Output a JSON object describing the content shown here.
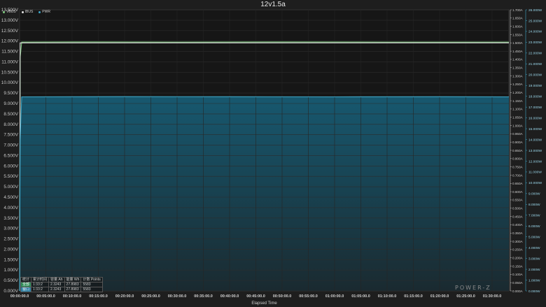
{
  "window": {
    "title": "12v1.5a"
  },
  "brand": "POWER-Z",
  "legend": [
    {
      "label": "VBUS",
      "color": "#7fc97f"
    },
    {
      "label": "IBUS",
      "color": "#e0e0e0"
    },
    {
      "label": "PWR",
      "color": "#3fa7c8"
    }
  ],
  "stats": {
    "header": [
      "统计",
      "累计时间",
      "容量 Ah",
      "能量 Wh",
      "计数 Points"
    ],
    "rows": [
      {
        "label": "全部",
        "time": "1:33:2",
        "ah": "2.3243",
        "wh": "27.8983",
        "points": "5583",
        "color": "#2e8b57"
      },
      {
        "label": "窗口",
        "time": "1:33:2",
        "ah": "2.3243",
        "wh": "27.8983",
        "points": "5583",
        "color": "#2d7fa3"
      }
    ]
  },
  "chart_data": {
    "type": "line",
    "title": "12v1.5a",
    "xlabel": "Elapsed Time",
    "x_ticks": [
      "00:00:00.0",
      "00:05:00.0",
      "00:10:00.0",
      "00:15:00.0",
      "00:20:00.0",
      "00:25:00.0",
      "00:30:00.0",
      "00:35:00.0",
      "00:40:00.0",
      "00:45:00.0",
      "00:50:00.0",
      "00:55:00.0",
      "01:00:00.0",
      "01:05:00.0",
      "01:10:00.0",
      "01:15:00.0",
      "01:20:00.0",
      "01:25:00.0",
      "01:30:00.0"
    ],
    "x_range_min": [
      0,
      93.2
    ],
    "y_left": {
      "unit": "V",
      "range": [
        0,
        13.5
      ],
      "ticks": [
        "0.000V",
        "0.500V",
        "1.000V",
        "1.500V",
        "2.000V",
        "2.500V",
        "3.000V",
        "3.500V",
        "4.000V",
        "4.500V",
        "5.000V",
        "5.500V",
        "6.000V",
        "6.500V",
        "7.000V",
        "7.500V",
        "8.000V",
        "8.500V",
        "9.000V",
        "9.500V",
        "10.000V",
        "10.500V",
        "11.000V",
        "11.500V",
        "12.000V",
        "12.500V",
        "13.000V",
        "13.500V"
      ]
    },
    "y_right_current": {
      "unit": "A",
      "range": [
        0,
        1.7
      ],
      "ticks": [
        "0.000A",
        "0.050A",
        "0.100A",
        "0.150A",
        "0.200A",
        "0.250A",
        "0.300A",
        "0.350A",
        "0.400A",
        "0.450A",
        "0.500A",
        "0.550A",
        "0.600A",
        "0.650A",
        "0.700A",
        "0.750A",
        "0.800A",
        "0.850A",
        "0.900A",
        "0.950A",
        "1.000A",
        "1.050A",
        "1.100A",
        "1.150A",
        "1.200A",
        "1.250A",
        "1.300A",
        "1.350A",
        "1.400A",
        "1.450A",
        "1.500A",
        "1.550A",
        "1.600A",
        "1.650A",
        "1.700A"
      ]
    },
    "y_right_power": {
      "unit": "W",
      "range": [
        0,
        26
      ],
      "ticks": [
        "0.000W",
        "1.000W",
        "2.000W",
        "3.000W",
        "4.000W",
        "5.000W",
        "6.000W",
        "7.000W",
        "8.000W",
        "9.000W",
        "10.000W",
        "11.000W",
        "12.000W",
        "13.000W",
        "14.000W",
        "15.000W",
        "16.000W",
        "17.000W",
        "18.000W",
        "19.000W",
        "20.000W",
        "21.000W",
        "22.000W",
        "23.000W",
        "24.000W",
        "25.000W",
        "26.000W"
      ]
    },
    "series": [
      {
        "name": "VBUS",
        "axis": "left",
        "color": "#7fc97f",
        "points": [
          [
            0,
            0
          ],
          [
            0.1,
            11.2
          ],
          [
            0.4,
            11.95
          ],
          [
            10,
            11.96
          ],
          [
            30,
            11.95
          ],
          [
            50,
            11.96
          ],
          [
            70,
            11.95
          ],
          [
            93.2,
            11.95
          ]
        ]
      },
      {
        "name": "IBUS",
        "axis": "current",
        "color": "#e0e0e0",
        "points": [
          [
            0,
            0
          ],
          [
            0.1,
            1.5
          ],
          [
            93.2,
            1.5
          ]
        ]
      },
      {
        "name": "PWR",
        "axis": "power",
        "color": "#3fa7c8",
        "points": [
          [
            0,
            0
          ],
          [
            0.1,
            14.0
          ],
          [
            0.4,
            17.95
          ],
          [
            20,
            17.97
          ],
          [
            40,
            17.96
          ],
          [
            60,
            17.95
          ],
          [
            80,
            17.96
          ],
          [
            93.2,
            17.95
          ]
        ]
      }
    ]
  }
}
